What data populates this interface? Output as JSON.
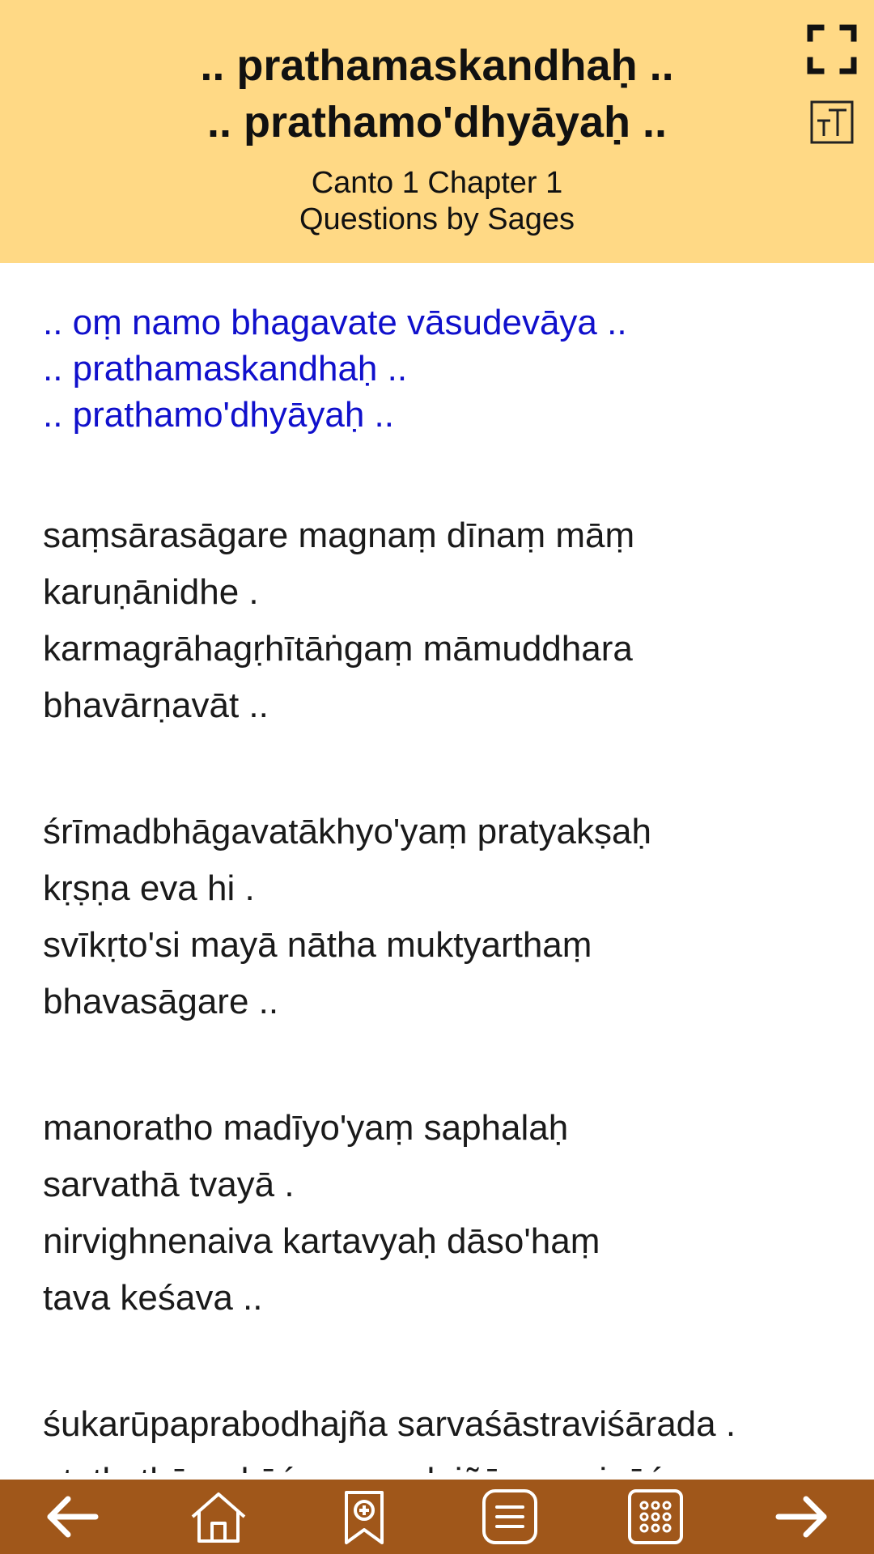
{
  "header": {
    "title_lines": [
      ".. prathamaskandhaḥ ..",
      ".. prathamo'dhyāyaḥ .."
    ],
    "subtitle_lines": [
      "Canto 1 Chapter 1",
      "Questions by Sages"
    ],
    "background": "#FFD985"
  },
  "toolbar": {
    "fullscreen_icon": "fullscreen-icon",
    "text_size_icon": "text-size-icon"
  },
  "content": {
    "heading_color": "#1010CC",
    "heading_lines": [
      ".. oṃ namo bhagavate vāsudevāya ..",
      ".. prathamaskandhaḥ ..",
      ".. prathamo'dhyāyaḥ .."
    ],
    "verses": [
      [
        "saṃsārasāgare magnaṃ dīnaṃ māṃ",
        "karuṇānidhe .",
        "karmagrāhagṛhītāṅgaṃ māmuddhara",
        "bhavārṇavāt .."
      ],
      [
        "śrīmadbhāgavatākhyo'yaṃ pratyakṣaḥ",
        "kṛṣṇa eva hi .",
        "svīkṛto'si mayā nātha muktyarthaṃ",
        "bhavasāgare .."
      ],
      [
        "manoratho madīyo'yaṃ saphalaḥ",
        "sarvathā tvayā .",
        "nirvighnenaiva kartavyaḥ dāso'haṃ",
        "tava keśava .."
      ],
      [
        "śukarūpaprabodhajña sarvaśāstraviśārada .",
        "etatkathāprakāśena madajñānaṃ vināśaya .."
      ]
    ]
  },
  "bottom_nav": {
    "background": "#A0571A",
    "items": [
      "back-arrow-icon",
      "home-icon",
      "bookmark-add-icon",
      "index-list-icon",
      "grid-menu-icon",
      "forward-arrow-icon"
    ]
  }
}
